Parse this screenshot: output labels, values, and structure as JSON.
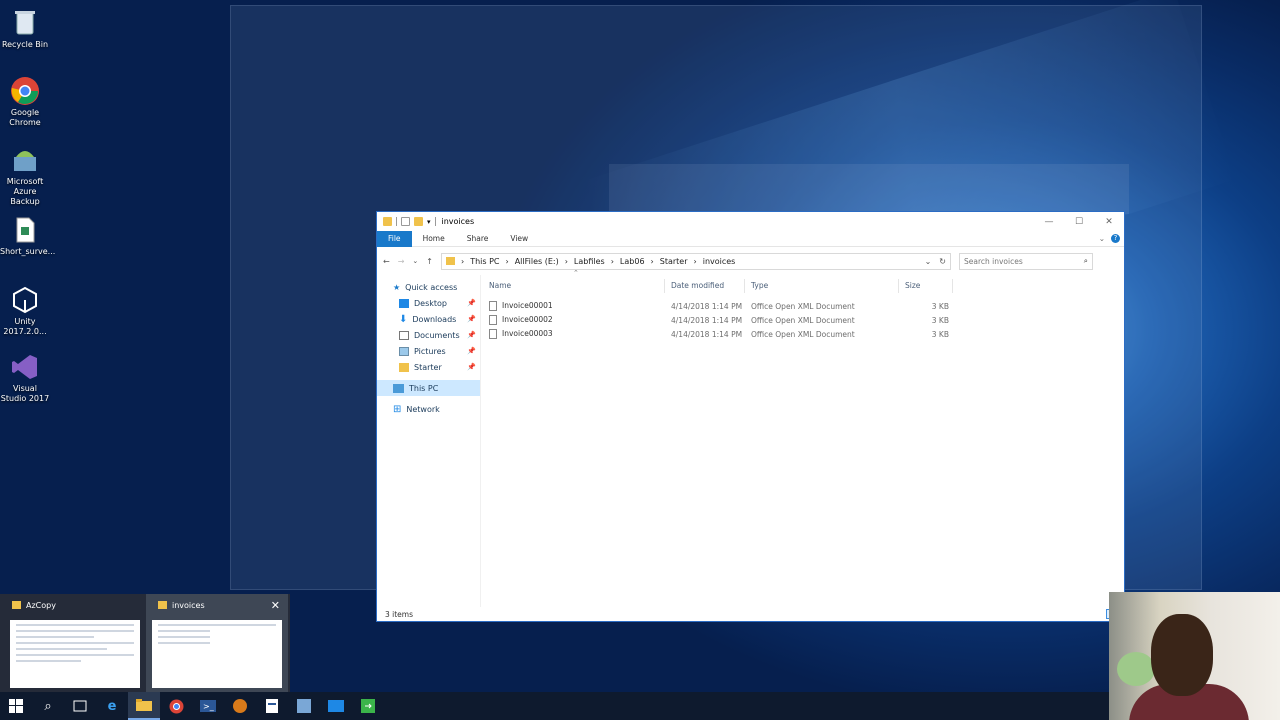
{
  "desktop": {
    "icons": [
      {
        "label": "Recycle Bin",
        "icon": "recycle-bin-icon"
      },
      {
        "label": "Google Chrome",
        "icon": "chrome-icon"
      },
      {
        "label": "Microsoft Azure Backup",
        "icon": "azure-backup-icon"
      },
      {
        "label": "Short_surve...",
        "icon": "spreadsheet-file-icon"
      },
      {
        "label": "Unity 2017.2.0...",
        "icon": "unity-icon"
      },
      {
        "label": "Visual Studio 2017",
        "icon": "visual-studio-icon"
      }
    ]
  },
  "explorer": {
    "title": "invoices",
    "window_controls": {
      "minimize": "—",
      "maximize": "☐",
      "close": "✕"
    },
    "ribbon": {
      "file": "File",
      "home": "Home",
      "share": "Share",
      "view": "View"
    },
    "breadcrumb": [
      "This PC",
      "AllFiles (E:)",
      "Labfiles",
      "Lab06",
      "Starter",
      "invoices"
    ],
    "search_placeholder": "Search invoices",
    "nav": {
      "quick_access": "Quick access",
      "desktop": "Desktop",
      "downloads": "Downloads",
      "documents": "Documents",
      "pictures": "Pictures",
      "starter": "Starter",
      "this_pc": "This PC",
      "network": "Network"
    },
    "columns": {
      "name": "Name",
      "date": "Date modified",
      "type": "Type",
      "size": "Size"
    },
    "files": [
      {
        "name": "Invoice00001",
        "date": "4/14/2018 1:14 PM",
        "type": "Office Open XML Document",
        "size": "3 KB"
      },
      {
        "name": "Invoice00002",
        "date": "4/14/2018 1:14 PM",
        "type": "Office Open XML Document",
        "size": "3 KB"
      },
      {
        "name": "Invoice00003",
        "date": "4/14/2018 1:14 PM",
        "type": "Office Open XML Document",
        "size": "3 KB"
      }
    ],
    "status": "3 items"
  },
  "thumbnails": [
    {
      "title": "AzCopy"
    },
    {
      "title": "invoices",
      "close": "✕"
    }
  ],
  "taskbar": [
    "start-icon",
    "search-icon",
    "task-view-icon",
    "edge-icon",
    "file-explorer-icon",
    "chrome-icon",
    "powershell-icon",
    "app-icon",
    "document-icon",
    "storage-explorer-icon",
    "azure-cli-icon",
    "exit-app-icon"
  ],
  "colors": {
    "accent": "#1979ca",
    "selection": "#cde8ff",
    "folder": "#f0c24b"
  }
}
